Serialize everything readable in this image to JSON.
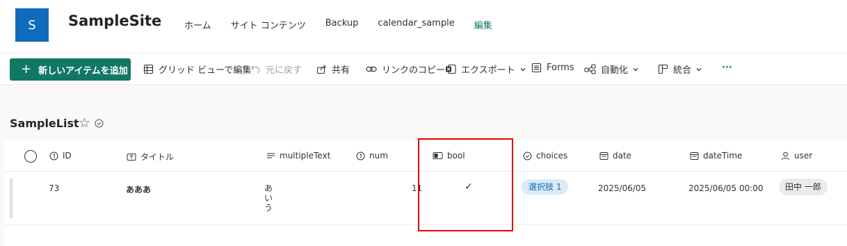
{
  "site": {
    "logo_letter": "S",
    "title": "SampleSite",
    "nav": [
      "ホーム",
      "サイト コンテンツ",
      "Backup",
      "calendar_sample",
      "編集"
    ]
  },
  "commands": {
    "new_item": "新しいアイテムを追加",
    "grid_edit": "グリッド ビューで編集",
    "undo": "元に戻す",
    "share": "共有",
    "copy_link": "リンクのコピー",
    "export": "エクスポート",
    "forms": "Forms",
    "automate": "自動化",
    "integrate": "統合",
    "more": "···"
  },
  "list": {
    "title": "SampleList",
    "columns": [
      "ID",
      "タイトル",
      "multipleText",
      "num",
      "bool",
      "choices",
      "date",
      "dateTime",
      "user"
    ],
    "row": {
      "id": "73",
      "title": "あああ",
      "multiple_text": [
        "あ",
        "い",
        "う"
      ],
      "num": "11",
      "bool": "✓",
      "choice": "選択肢 1",
      "date": "2025/06/05",
      "datetime": "2025/06/05 00:00",
      "user": "田中 一郎"
    }
  },
  "colors": {
    "brand": "#0f6cbd",
    "primary_button": "#117865",
    "highlight": "#e00000"
  }
}
